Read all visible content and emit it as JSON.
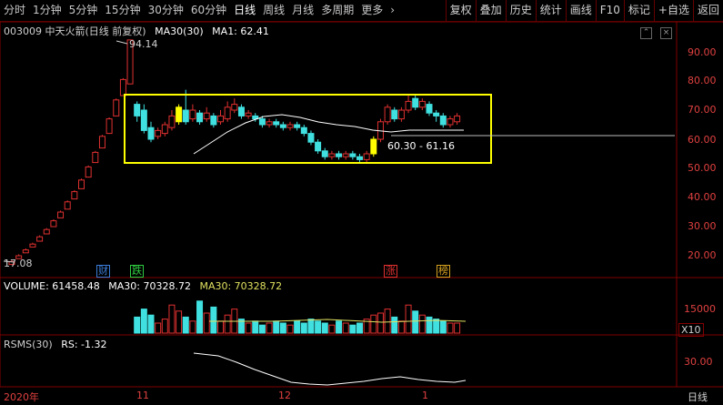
{
  "toolbar": {
    "periods": [
      "分时",
      "1分钟",
      "5分钟",
      "15分钟",
      "30分钟",
      "60分钟",
      "日线",
      "周线",
      "月线",
      "多周期",
      "更多"
    ],
    "active_period": "日线",
    "more_chevron": "›",
    "actions": [
      "复权",
      "叠加",
      "历史",
      "统计",
      "画线",
      "F10",
      "标记",
      "+自选",
      "返回"
    ]
  },
  "price_header": {
    "title": "003009 中天火箭(日线 前复权)",
    "ma30": "MA30(30)",
    "ma1": "MA1: 62.41"
  },
  "price_axis": [
    "90.00",
    "80.00",
    "70.00",
    "60.00",
    "50.00",
    "40.00",
    "30.00",
    "20.00"
  ],
  "annotations": {
    "high": "94.14",
    "low": "17.08",
    "box_range": "60.30 - 61.16"
  },
  "event_tags": [
    {
      "text": "财",
      "color": "#3a7bd5"
    },
    {
      "text": "跌",
      "color": "#2ecc40"
    },
    {
      "text": "涨",
      "color": "#e03030"
    },
    {
      "text": "榜",
      "color": "#d4a020"
    }
  ],
  "volume_header": {
    "volume": "VOLUME: 61458.48",
    "ma30": "MA30: 70328.72",
    "ma30b": "MA30: 70328.72"
  },
  "volume_axis": {
    "top": "15000",
    "unit": "X10"
  },
  "rsms_header": {
    "label": "RSMS(30)",
    "rs": "RS: -1.32"
  },
  "rsms_axis": {
    "value": "30.00"
  },
  "dates": {
    "year": "2020年",
    "nov": "11",
    "dec": "12",
    "jan": "1",
    "period": "日线"
  },
  "colors": {
    "up": "#e03030",
    "down": "#40e0e0",
    "highlight": "#ffff00",
    "ma": "#ffffff",
    "axis": "#800000"
  }
}
